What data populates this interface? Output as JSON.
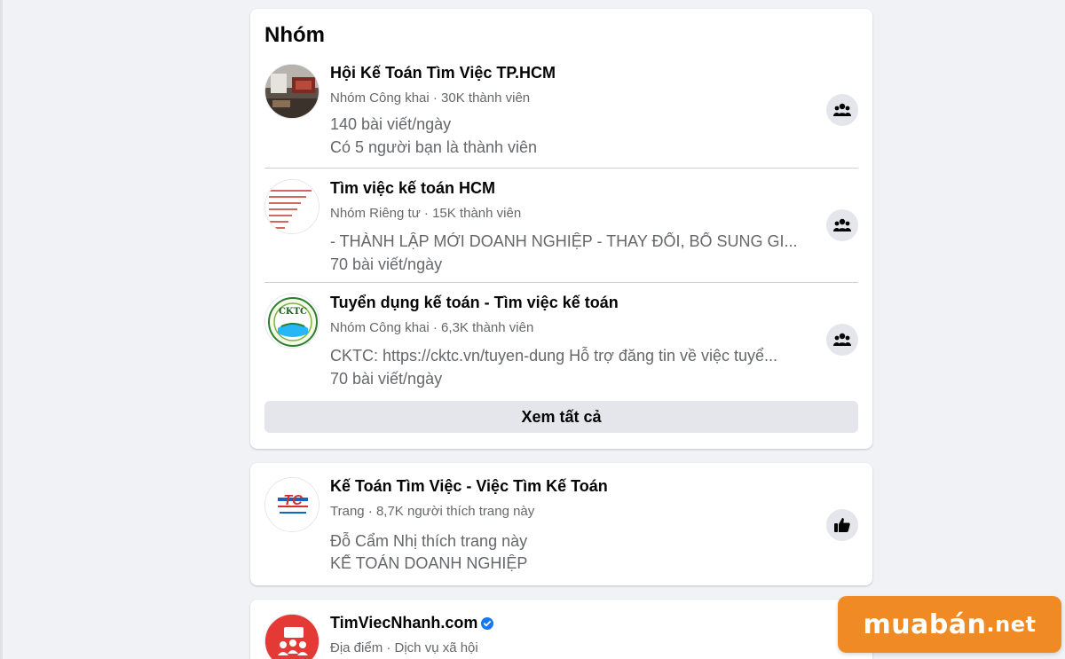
{
  "groups_card": {
    "title": "Nhóm",
    "items": [
      {
        "name": "Hội Kế Toán Tìm Việc TP.HCM",
        "meta": "Nhóm Công khai · 30K thành viên",
        "line1": "140 bài viết/ngày",
        "line2": "Có 5 người bạn là thành viên",
        "action_icon": "join-group-icon"
      },
      {
        "name": "Tìm việc kế toán HCM",
        "meta": "Nhóm Riêng tư · 15K thành viên",
        "line1": "- THÀNH LẬP MỚI DOANH NGHIỆP - THAY ĐỔI, BỔ SUNG GI...",
        "line2": "70 bài viết/ngày",
        "action_icon": "join-group-icon"
      },
      {
        "name": "Tuyển dụng kế toán - Tìm việc kế toán",
        "meta": "Nhóm Công khai · 6,3K thành viên",
        "line1": "CKTC: https://cktc.vn/tuyen-dung Hỗ trợ đăng tin về việc tuyể...",
        "line2": "70 bài viết/ngày",
        "avatar_text": "CKTC",
        "action_icon": "join-group-icon"
      }
    ],
    "see_all_label": "Xem tất cả"
  },
  "page_card": {
    "name": "Kế Toán Tìm Việc - Việc Tìm Kế Toán",
    "meta": "Trang · 8,7K người thích trang này",
    "line1": "Đỗ Cẩm Nhị thích trang này",
    "line2": "KẾ TOÁN DOANH NGHIỆP",
    "avatar_text": "TC",
    "action_icon": "like-icon"
  },
  "place_card": {
    "name": "TimViecNhanh.com",
    "meta": "Địa điểm · Dịch vụ xã hội",
    "verified_icon": "verified-badge-icon"
  },
  "watermark": {
    "text_main": "muabán",
    "text_suffix": ".net"
  },
  "colors": {
    "background": "#f0f2f5",
    "card": "#ffffff",
    "secondary_text": "#65676b",
    "button_bg": "#e4e6eb",
    "verified": "#1877f2",
    "brand": "#f08a24"
  }
}
